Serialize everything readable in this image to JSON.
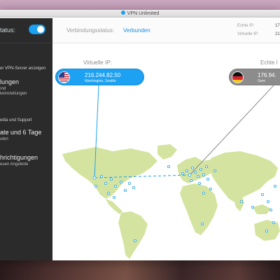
{
  "window": {
    "title": "VPN Unlimited"
  },
  "sidebar": {
    "status_label": "tatus:",
    "toggle_on": true,
    "items": [
      {
        "single": "er VPN-Server anzeigen"
      },
      {
        "big": "lungen",
        "small": "ınd",
        "small2": "keinstellungen"
      },
      {
        "single": "edia und Support"
      },
      {
        "big": "ate und 6 Tage",
        "small": "uten"
      },
      {
        "big": "hrichtigungen",
        "small": "euen Angebote"
      }
    ]
  },
  "connection": {
    "status_label": "Verbindungsstatus:",
    "status_value": "Verbunden",
    "real_ip_label": "Echte IP:",
    "real_ip_value": "17",
    "virtual_ip_label": "Virtuelle IP:",
    "virtual_ip_value": "21"
  },
  "virtual": {
    "label": "Virtuelle IP:",
    "ip": "216.244.82.50",
    "location": "Washington, Seattle",
    "flag": "us-flag"
  },
  "real": {
    "label": "Echte I",
    "ip": "176.94.",
    "location": "Gern",
    "flag": "de-flag"
  },
  "colors": {
    "accent": "#1da1f2",
    "sidebar": "#2b2b2b",
    "map_land": "#d4e4a0",
    "server_dot": "#1da1f2"
  }
}
